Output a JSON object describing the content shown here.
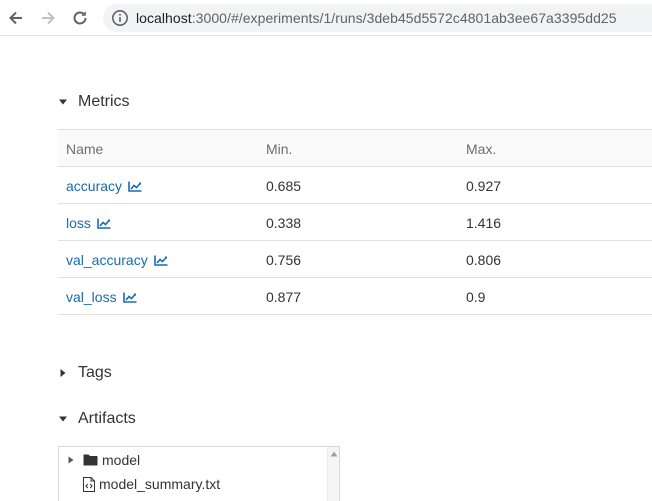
{
  "browser": {
    "url_host": "localhost",
    "url_path": ":3000/#/experiments/1/runs/3deb45d5572c4801ab3ee67a3395dd25",
    "icons": [
      "back-arrow-icon",
      "forward-arrow-icon",
      "reload-icon",
      "info-icon"
    ]
  },
  "sections": {
    "metrics": "Metrics",
    "tags": "Tags",
    "artifacts": "Artifacts"
  },
  "metrics_table": {
    "headers": [
      "Name",
      "Min.",
      "Max."
    ],
    "rows": [
      {
        "name": "accuracy",
        "min": "0.685",
        "max": "0.927"
      },
      {
        "name": "loss",
        "min": "0.338",
        "max": "1.416"
      },
      {
        "name": "val_accuracy",
        "min": "0.756",
        "max": "0.806"
      },
      {
        "name": "val_loss",
        "min": "0.877",
        "max": "0.9"
      }
    ]
  },
  "artifacts": {
    "items": [
      {
        "name": "model",
        "type": "folder"
      },
      {
        "name": "model_summary.txt",
        "type": "file"
      }
    ]
  },
  "colors": {
    "link": "#1a6bb0",
    "text": "#333333",
    "header_text": "#6e6e6e",
    "border": "#e1e1e1"
  }
}
